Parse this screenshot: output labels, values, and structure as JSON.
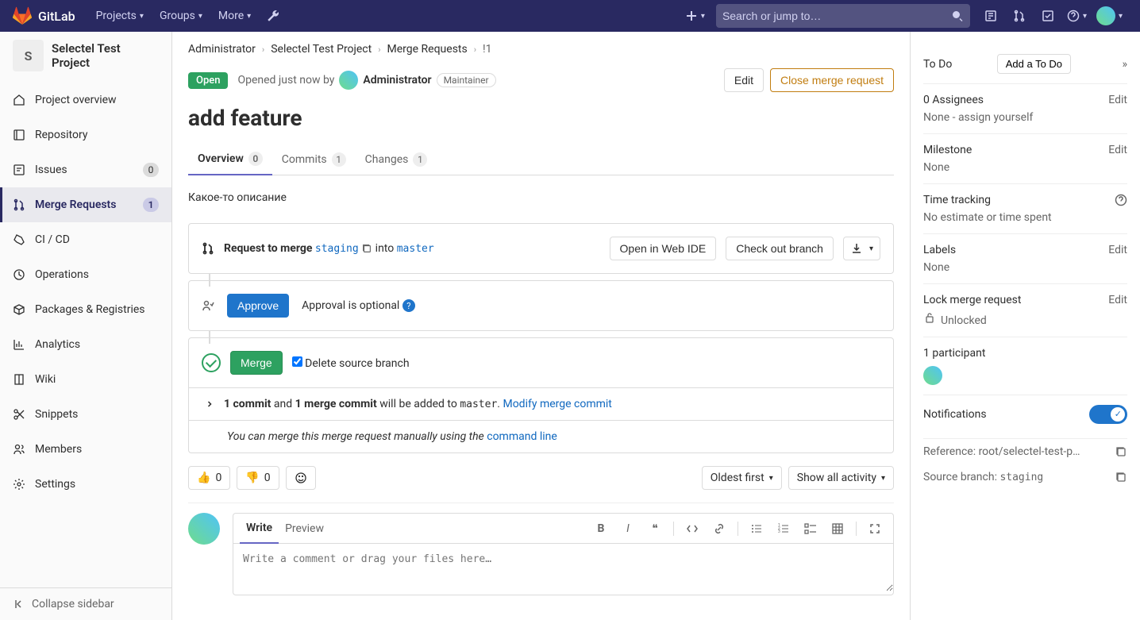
{
  "navbar": {
    "brand": "GitLab",
    "items": [
      "Projects",
      "Groups",
      "More"
    ],
    "search_placeholder": "Search or jump to…"
  },
  "sidebar": {
    "project_initial": "S",
    "project_name": "Selectel Test Project",
    "items": [
      {
        "label": "Project overview"
      },
      {
        "label": "Repository"
      },
      {
        "label": "Issues",
        "badge": "0"
      },
      {
        "label": "Merge Requests",
        "badge": "1",
        "active": true
      },
      {
        "label": "CI / CD"
      },
      {
        "label": "Operations"
      },
      {
        "label": "Packages & Registries"
      },
      {
        "label": "Analytics"
      },
      {
        "label": "Wiki"
      },
      {
        "label": "Snippets"
      },
      {
        "label": "Members"
      },
      {
        "label": "Settings"
      }
    ],
    "collapse": "Collapse sidebar"
  },
  "breadcrumbs": [
    "Administrator",
    "Selectel Test Project",
    "Merge Requests",
    "!1"
  ],
  "mr": {
    "status": "Open",
    "opened_text": "Opened just now by",
    "author": "Administrator",
    "role": "Maintainer",
    "edit_btn": "Edit",
    "close_btn": "Close merge request",
    "title": "add feature",
    "tabs": [
      {
        "label": "Overview",
        "count": "0",
        "active": true
      },
      {
        "label": "Commits",
        "count": "1"
      },
      {
        "label": "Changes",
        "count": "1"
      }
    ],
    "description": "Какое-то описание",
    "request_text": "Request to merge",
    "source_branch": "staging",
    "into_text": "into",
    "target_branch": "master",
    "open_ide": "Open in Web IDE",
    "checkout": "Check out branch",
    "approve": "Approve",
    "approval_optional": "Approval is optional",
    "merge": "Merge",
    "delete_branch": "Delete source branch",
    "commit_count_bold": "1 commit",
    "commit_and": "and",
    "merge_commit_bold": "1 merge commit",
    "will_be_added": "will be added to",
    "target_mono": "master",
    "modify_link": "Modify merge commit",
    "manual_merge": "You can merge this merge request manually using the",
    "command_line": "command line",
    "reactions": {
      "thumbs_up": "0",
      "thumbs_down": "0"
    },
    "sort_by": "Oldest first",
    "activity_filter": "Show all activity",
    "comment": {
      "write": "Write",
      "preview": "Preview",
      "placeholder": "Write a comment or drag your files here…"
    }
  },
  "right": {
    "todo": {
      "title": "To Do",
      "button": "Add a To Do"
    },
    "assignees": {
      "title": "0 Assignees",
      "edit": "Edit",
      "body": "None - assign yourself"
    },
    "milestone": {
      "title": "Milestone",
      "edit": "Edit",
      "body": "None"
    },
    "time": {
      "title": "Time tracking",
      "body": "No estimate or time spent"
    },
    "labels": {
      "title": "Labels",
      "edit": "Edit",
      "body": "None"
    },
    "lock": {
      "title": "Lock merge request",
      "edit": "Edit",
      "body": "Unlocked"
    },
    "participants": {
      "title": "1 participant"
    },
    "notifications": {
      "title": "Notifications"
    },
    "reference": {
      "label": "Reference:",
      "value": "root/selectel-test-p…"
    },
    "source": {
      "label": "Source branch:",
      "value": "staging"
    }
  }
}
